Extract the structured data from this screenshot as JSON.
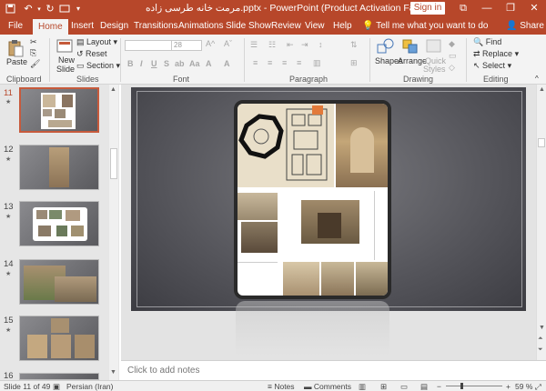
{
  "titlebar": {
    "title": "مرمت خانه طرسی زاده.pptx - PowerPoint (Product Activation Failed)",
    "sign_in": "Sign in",
    "min": "—",
    "restore": "❐",
    "close": "✕",
    "ribbon_display": "⧉"
  },
  "tabs": [
    "File",
    "Home",
    "Insert",
    "Design",
    "Transitions",
    "Animations",
    "Slide Show",
    "Review",
    "View",
    "Help"
  ],
  "tell_me": "Tell me what you want to do",
  "share": "Share",
  "ribbon": {
    "clipboard": {
      "label": "Clipboard",
      "paste": "Paste"
    },
    "slides": {
      "label": "Slides",
      "new_slide": "New",
      "new_slide2": "Slide",
      "layout": "Layout",
      "reset": "Reset",
      "section": "Section"
    },
    "font": {
      "label": "Font",
      "size": "28"
    },
    "paragraph": {
      "label": "Paragraph"
    },
    "drawing": {
      "label": "Drawing",
      "shapes": "Shapes",
      "arrange": "Arrange",
      "quick_styles": "Quick",
      "quick_styles2": "Styles"
    },
    "editing": {
      "label": "Editing",
      "find": "Find",
      "replace": "Replace",
      "select": "Select"
    }
  },
  "thumbnails": [
    {
      "num": "11",
      "active": true
    },
    {
      "num": "12",
      "active": false
    },
    {
      "num": "13",
      "active": false
    },
    {
      "num": "14",
      "active": false
    },
    {
      "num": "15",
      "active": false
    },
    {
      "num": "16",
      "active": false
    }
  ],
  "notes_placeholder": "Click to add notes",
  "status": {
    "slide": "Slide 11 of 49",
    "language": "Persian (Iran)",
    "notes": "Notes",
    "comments": "Comments",
    "zoom": "59 %"
  },
  "colors": {
    "accent": "#b7472a"
  }
}
